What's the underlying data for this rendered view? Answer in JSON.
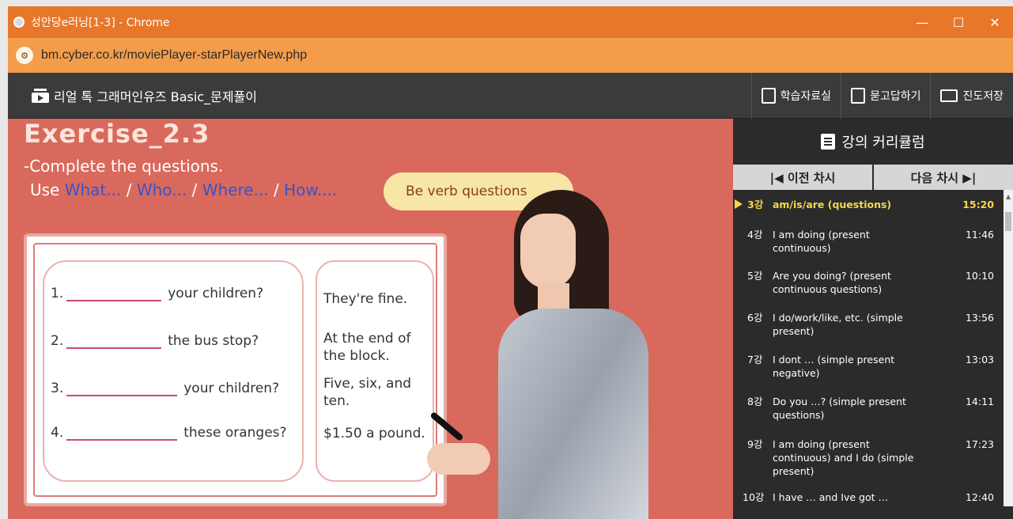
{
  "window": {
    "title": "성안당e러닝[1-3] - Chrome",
    "minimize": "—",
    "maximize": "☐",
    "close": "✕"
  },
  "address": {
    "url": "bm.cyber.co.kr/moviePlayer-starPlayerNew.php"
  },
  "header": {
    "course_title": "리얼 톡 그래머인유즈 Basic_문제풀이",
    "buttons": [
      "학습자료실",
      "묻고답하기",
      "진도저장"
    ]
  },
  "video": {
    "exercise_title": "Exercise_2.3",
    "instruction1": "-Complete the questions.",
    "instruction2_prefix": "Use ",
    "instruction2_words": [
      "What...",
      "Who...",
      "Where...",
      "How...."
    ],
    "pill": "Be verb questions",
    "questions": [
      {
        "num": "1.",
        "text": "your children?"
      },
      {
        "num": "2.",
        "text": "the bus stop?"
      },
      {
        "num": "3.",
        "text": "your children?"
      },
      {
        "num": "4.",
        "text": "these oranges?"
      }
    ],
    "answers": [
      "They're fine.",
      "At the end of the block.",
      "Five, six, and ten.",
      "$1.50 a pound."
    ]
  },
  "sidebar": {
    "title": "강의 커리큘럼",
    "prev": "|◀ 이전 차시",
    "next": "다음 차시 ▶|",
    "items": [
      {
        "num": "3강",
        "title": "am/is/are (questions)",
        "duration": "15:20",
        "active": true
      },
      {
        "num": "4강",
        "title": "I am doing (present continuous)",
        "duration": "11:46"
      },
      {
        "num": "5강",
        "title": "Are you doing? (present continuous questions)",
        "duration": "10:10"
      },
      {
        "num": "6강",
        "title": "I do/work/like, etc. (simple present)",
        "duration": "13:56"
      },
      {
        "num": "7강",
        "title": "I dont … (simple present negative)",
        "duration": "13:03"
      },
      {
        "num": "8강",
        "title": "Do you …? (simple present questions)",
        "duration": "14:11"
      },
      {
        "num": "9강",
        "title": "I am doing (present continuous) and I do (simple present)",
        "duration": "17:23"
      },
      {
        "num": "10강",
        "title": "I have … and Ive got …",
        "duration": "12:40"
      }
    ]
  },
  "colors": {
    "titlebar": "#e8772a",
    "urlbar": "#f39d4a",
    "video_bg": "#d9695c",
    "active_item": "#f5d64a"
  }
}
